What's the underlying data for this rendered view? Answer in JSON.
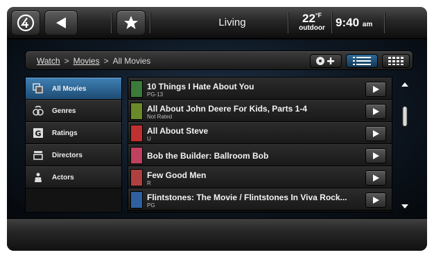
{
  "topbar": {
    "home_icon": "home-logo-icon",
    "back_icon": "back-arrow-icon",
    "favorite_icon": "star-icon",
    "room": "Living",
    "temperature": "22",
    "temperature_unit": "°F",
    "temperature_label": "outdoor",
    "time": "9:40",
    "ampm": "am"
  },
  "breadcrumb": {
    "items": [
      "Watch",
      "Movies",
      "All Movies"
    ],
    "separator": ">"
  },
  "view_controls": {
    "add_icon": "disc-plus-icon",
    "list_view_icon": "list-view-icon",
    "grid_view_icon": "grid-view-icon",
    "active": "list"
  },
  "sidebar": {
    "items": [
      {
        "label": "All Movies",
        "icon": "all-movies-icon",
        "selected": true
      },
      {
        "label": "Genres",
        "icon": "genres-icon",
        "selected": false
      },
      {
        "label": "Ratings",
        "icon": "ratings-icon",
        "selected": false
      },
      {
        "label": "Directors",
        "icon": "directors-icon",
        "selected": false
      },
      {
        "label": "Actors",
        "icon": "actors-icon",
        "selected": false
      }
    ]
  },
  "movies": [
    {
      "title": "10 Things I Hate About You",
      "rating": "PG-13",
      "color": "#3a7a3a"
    },
    {
      "title": "All About John Deere For Kids, Parts 1-4",
      "rating": "Not Rated",
      "color": "#6a8a2a"
    },
    {
      "title": "All About Steve",
      "rating": "U",
      "color": "#c03030"
    },
    {
      "title": "Bob the Builder: Ballroom Bob",
      "rating": "",
      "color": "#c04060"
    },
    {
      "title": "Few Good Men",
      "rating": "R",
      "color": "#b04040"
    },
    {
      "title": "Flintstones: The Movie / Flintstones In Viva Rock...",
      "rating": "PG",
      "color": "#3060a0"
    }
  ],
  "theme": {
    "accent": "#2f6fa3",
    "background": "#050505"
  }
}
